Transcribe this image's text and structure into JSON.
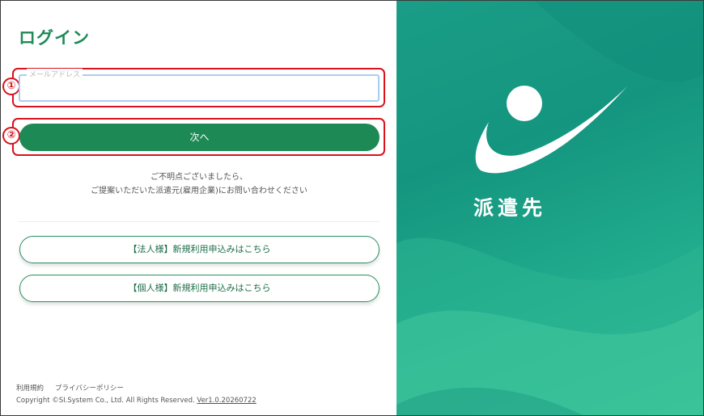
{
  "login": {
    "title": "ログイン",
    "email_label": "メールアドレス",
    "email_value": "",
    "next_button": "次へ",
    "contact_line1": "ご不明点ございましたら、",
    "contact_line2": "ご提案いただいた派遣元(雇用企業)にお問い合わせください",
    "corporate_signup": "【法人様】新規利用申込みはこちら",
    "individual_signup": "【個人様】新規利用申込みはこちら"
  },
  "annotations": {
    "marker1": "①",
    "marker2": "②",
    "color": "#d9121b"
  },
  "footer": {
    "terms": "利用規約",
    "privacy": "プライバシーポリシー",
    "copyright": "Copyright ©SI.System Co., Ltd. All Rights Reserved.",
    "version": "Ver1.0.20260722"
  },
  "brand": {
    "label": "派遣先",
    "accent_color": "#1d8a55",
    "panel_color": "#1a9d86"
  }
}
